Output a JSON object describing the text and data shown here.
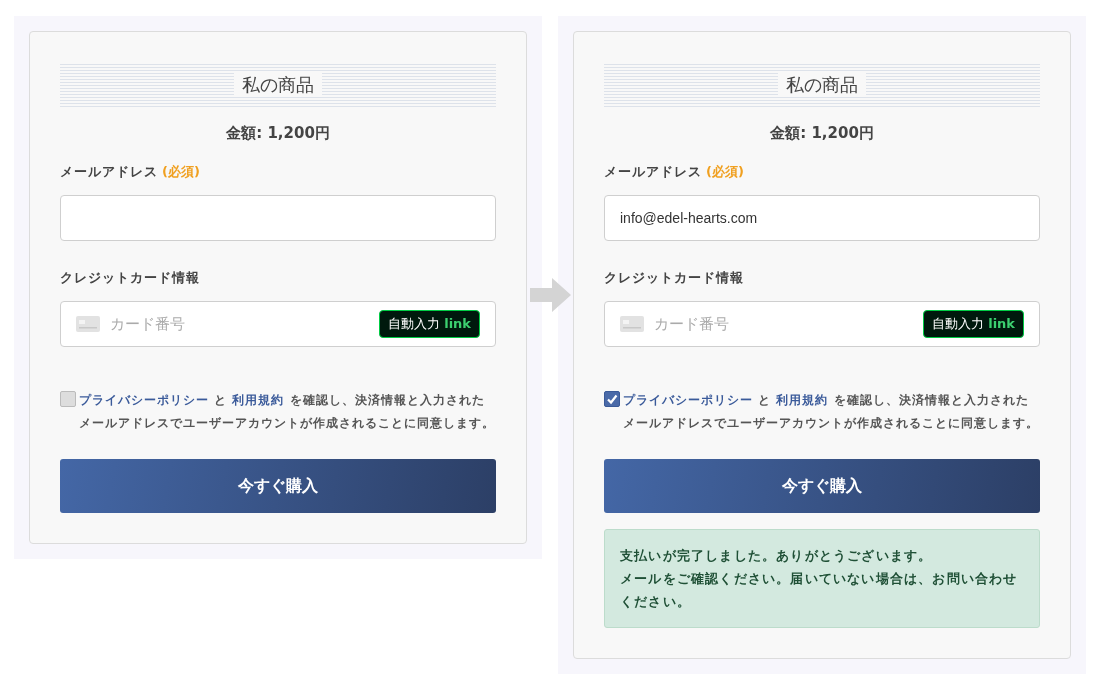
{
  "panels": [
    {
      "title": "私の商品",
      "amount": "金額: 1,200円",
      "email_label": "メールアドレス",
      "required": "(必須)",
      "card_label": "クレジットカード情報",
      "card_placeholder": "カード番号",
      "autofill": "自動入力",
      "autofill_brand": "link",
      "consent": {
        "checked": false,
        "policy_link": "プライバシーポリシー",
        "joiner": "と",
        "terms_link": "利用規約",
        "rest": "を確認し、決済情報と入力されたメールアドレスでユーザーアカウントが作成されることに同意します。"
      },
      "button": "今すぐ購入"
    },
    {
      "title": "私の商品",
      "amount": "金額: 1,200円",
      "email_label": "メールアドレス",
      "required": "(必須)",
      "email_value": "info@edel-hearts.com",
      "card_label": "クレジットカード情報",
      "card_placeholder": "カード番号",
      "autofill": "自動入力",
      "autofill_brand": "link",
      "consent": {
        "checked": true,
        "policy_link": "プライバシーポリシー",
        "joiner": "と",
        "terms_link": "利用規約",
        "rest": "を確認し、決済情報と入力されたメールアドレスでユーザーアカウントが作成されることに同意します。"
      },
      "button": "今すぐ購入",
      "success": [
        "支払いが完了しました。ありがとうございます。",
        "メールをご確認ください。届いていない場合は、お問い合わせください。"
      ]
    }
  ]
}
